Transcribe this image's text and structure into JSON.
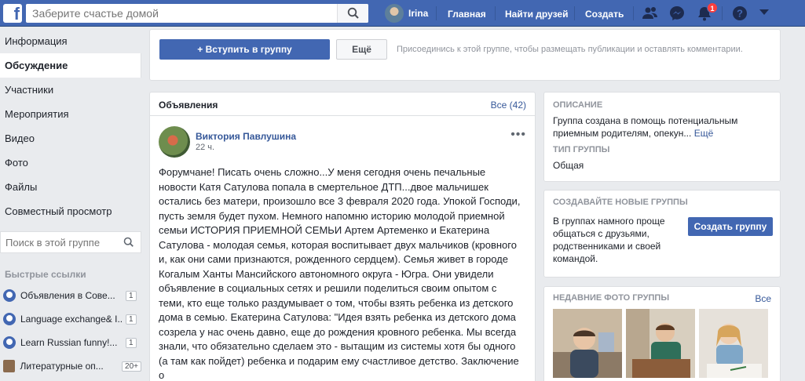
{
  "topbar": {
    "search_placeholder": "Заберите счастье домой",
    "user_name": "Irina",
    "nav_home": "Главная",
    "nav_find_friends": "Найти друзей",
    "nav_create": "Создать",
    "notifications_count": "1",
    "colors": {
      "bar": "#4267b2",
      "badge": "#fa3e3e"
    },
    "icons": [
      "facebook-logo-icon",
      "search-icon",
      "friend-requests-icon",
      "messenger-icon",
      "notifications-bell-icon",
      "help-icon",
      "dropdown-arrow-icon"
    ]
  },
  "sidebar": {
    "items": [
      {
        "label": "Информация"
      },
      {
        "label": "Обсуждение"
      },
      {
        "label": "Участники"
      },
      {
        "label": "Мероприятия"
      },
      {
        "label": "Видео"
      },
      {
        "label": "Фото"
      },
      {
        "label": "Файлы"
      },
      {
        "label": "Совместный просмотр"
      }
    ],
    "active": "Обсуждение",
    "search_placeholder": "Поиск в этой группе",
    "quick_links_title": "Быстрые ссылки",
    "quick_links": [
      {
        "label": "Объявления в Сове...",
        "count": "1"
      },
      {
        "label": "Language exchange& I...",
        "count": "1"
      },
      {
        "label": "Learn Russian funny!...",
        "count": "1"
      },
      {
        "label": "Литературные оп...",
        "count": "20+"
      }
    ]
  },
  "join": {
    "join_label": "+ Вступить в группу",
    "more_label": "Ещё",
    "hint": "Присоединись к этой группе, чтобы размещать публикации и оставлять комментарии."
  },
  "announcements": {
    "title": "Объявления",
    "all_label": "Все (42)",
    "post": {
      "author": "Виктория Павлушина",
      "time": "22 ч.",
      "more_icon": "•••",
      "text": "Форумчане! Писать очень сложно...У меня сегодня очень печальные новости Катя Сатулова попала в смертельное ДТП...двое мальчишек остались без матери, произошло все 3 февраля 2020 года. Упокой Господи, пусть земля будет пухом. Немного напомню историю молодой приемной семьи ИСТОРИЯ ПРИЕМНОЙ СЕМЬИ Артем Артеменко и Екатерина Сатулова - молодая семья, которая воспитывает двух мальчиков (кровного и, как они сами признаются, рожденного сердцем). Семья живет в городе Когалым Ханты Мансийского автономного округа - Югра. Они увидели объявление в социальных сетях и решили поделиться своим опытом с теми, кто еще только раздумывает о том, чтобы взять ребенка из детского дома в семью.  Екатерина Сатулова: \"Идея взять ребенка из детского дома созрела у нас очень давно, еще до рождения кровного ребенка. Мы всегда знали, что обязательно сделаем это - вытащим из системы хотя бы одного (а там как пойдет) ребенка и подарим ему счастливое детство.  Заключение о"
    }
  },
  "about": {
    "description_head": "Описание",
    "description_text": "Группа создана в помощь потенциальным приемным родителям, опекун...",
    "description_more": "Ещё",
    "type_head": "Тип группы",
    "type_value": "Общая"
  },
  "create_groups": {
    "head": "Создавайте новые группы",
    "text": "В группах намного проще общаться с друзьями, родственниками и своей командой.",
    "button": "Создать группу"
  },
  "recent_photos": {
    "head": "Недавние фото группы",
    "all_label": "Все"
  }
}
